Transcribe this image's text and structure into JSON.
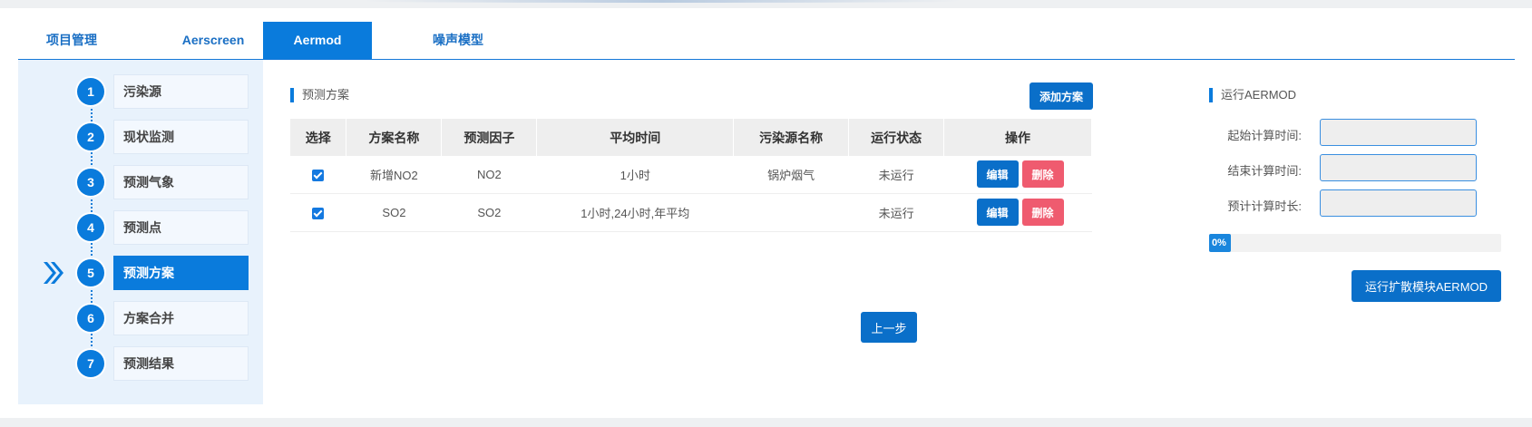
{
  "tabs": [
    {
      "label": "项目管理",
      "active": false
    },
    {
      "label": "Aerscreen",
      "active": false
    },
    {
      "label": "Aermod",
      "active": true
    },
    {
      "label": "噪声模型",
      "active": false
    }
  ],
  "steps": [
    {
      "num": "1",
      "label": "污染源"
    },
    {
      "num": "2",
      "label": "现状监测"
    },
    {
      "num": "3",
      "label": "预测气象"
    },
    {
      "num": "4",
      "label": "预测点"
    },
    {
      "num": "5",
      "label": "预测方案",
      "active": true
    },
    {
      "num": "6",
      "label": "方案合并"
    },
    {
      "num": "7",
      "label": "预测结果"
    }
  ],
  "scheme": {
    "title": "预测方案",
    "add_button": "添加方案",
    "columns": [
      "选择",
      "方案名称",
      "预测因子",
      "平均时间",
      "污染源名称",
      "运行状态",
      "操作"
    ],
    "rows": [
      {
        "checked": true,
        "name": "新增NO2",
        "factor": "NO2",
        "avg_time": "1小时",
        "source": "锅炉烟气",
        "status": "未运行"
      },
      {
        "checked": true,
        "name": "SO2",
        "factor": "SO2",
        "avg_time": "1小时,24小时,年平均",
        "source": "",
        "status": "未运行"
      }
    ],
    "edit_label": "编辑",
    "delete_label": "删除",
    "prev_button": "上一步"
  },
  "run": {
    "title": "运行AERMOD",
    "start_label": "起始计算时间:",
    "end_label": "结束计算时间:",
    "estimate_label": "预计计算时长:",
    "start_value": "",
    "end_value": "",
    "estimate_value": "",
    "progress_text": "0%",
    "progress_value": 0,
    "run_button": "运行扩散模块AERMOD"
  },
  "colors": {
    "accent": "#0a7bdc",
    "danger": "#ef5b6f"
  }
}
